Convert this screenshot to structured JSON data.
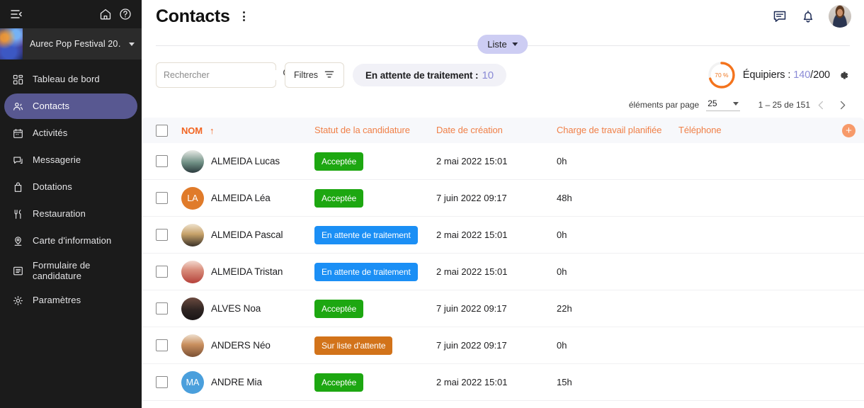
{
  "sidebar": {
    "collapse_icon": "collapse-sidebar-icon",
    "home_icon": "home-icon",
    "help_icon": "help-circle-icon",
    "workspace": {
      "name": "Aurec Pop Festival 20…"
    },
    "items": [
      {
        "label": "Tableau de bord",
        "icon": "dashboard-icon",
        "active": false
      },
      {
        "label": "Contacts",
        "icon": "contacts-icon",
        "active": true
      },
      {
        "label": "Activités",
        "icon": "calendar-icon",
        "active": false
      },
      {
        "label": "Messagerie",
        "icon": "message-icon",
        "active": false
      },
      {
        "label": "Dotations",
        "icon": "bag-icon",
        "active": false
      },
      {
        "label": "Restauration",
        "icon": "cutlery-icon",
        "active": false
      },
      {
        "label": "Carte d'information",
        "icon": "map-pin-icon",
        "active": false
      },
      {
        "label": "Formulaire de candidature",
        "icon": "form-list-icon",
        "active": false
      },
      {
        "label": "Paramètres",
        "icon": "gear-icon",
        "active": false
      }
    ]
  },
  "header": {
    "title": "Contacts",
    "kebab_icon": "more-vertical-icon",
    "chat_icon": "chat-icon",
    "bell_icon": "bell-icon",
    "avatar": "user-avatar"
  },
  "view_switch": {
    "label": "Liste"
  },
  "toolbar": {
    "search_placeholder": "Rechercher",
    "search_value": "",
    "search_icon": "search-icon",
    "filters_label": "Filtres",
    "filters_icon": "filter-icon",
    "pending_label": "En attente de traitement :",
    "pending_count": "10",
    "equipiers_label": "Équipiers :",
    "equipiers_current": "140",
    "equipiers_total": "/200",
    "progress_percent": "70 %",
    "progress_value": 70,
    "gear_icon": "gear-icon"
  },
  "pagination": {
    "per_page_label": "éléments par page",
    "per_page_value": "25",
    "range_label": "1 – 25 de 151",
    "prev_icon": "chevron-left-icon",
    "next_icon": "chevron-right-icon"
  },
  "table": {
    "columns": [
      {
        "label": "NOM",
        "sorted": true,
        "sort_arrow": "↑"
      },
      {
        "label": "Statut de la candidature"
      },
      {
        "label": "Date de création"
      },
      {
        "label": "Charge de travail planifiée"
      },
      {
        "label": "Téléphone"
      }
    ],
    "add_column_label": "+",
    "rows": [
      {
        "name": "ALMEIDA Lucas",
        "avatar_type": "photo",
        "avatar_style": "photo-a",
        "initials": "",
        "status": "Acceptée",
        "status_color": "#1da711",
        "date": "2 mai 2022 15:01",
        "workload": "0h",
        "phone": ""
      },
      {
        "name": "ALMEIDA Léa",
        "avatar_type": "initials",
        "avatar_style": "",
        "initials": "LA",
        "avatar_color": "#e07b2a",
        "status": "Acceptée",
        "status_color": "#1da711",
        "date": "7 juin 2022 09:17",
        "workload": "48h",
        "phone": ""
      },
      {
        "name": "ALMEIDA Pascal",
        "avatar_type": "photo",
        "avatar_style": "photo-b",
        "initials": "",
        "status": "En attente de traitement",
        "status_color": "#1b8ff5",
        "date": "2 mai 2022 15:01",
        "workload": "0h",
        "phone": ""
      },
      {
        "name": "ALMEIDA Tristan",
        "avatar_type": "photo",
        "avatar_style": "photo-c",
        "initials": "",
        "status": "En attente de traitement",
        "status_color": "#1b8ff5",
        "date": "2 mai 2022 15:01",
        "workload": "0h",
        "phone": ""
      },
      {
        "name": "ALVES Noa",
        "avatar_type": "photo",
        "avatar_style": "photo-d",
        "initials": "",
        "status": "Acceptée",
        "status_color": "#1da711",
        "date": "7 juin 2022 09:17",
        "workload": "22h",
        "phone": ""
      },
      {
        "name": "ANDERS Néo",
        "avatar_type": "photo",
        "avatar_style": "photo-e",
        "initials": "",
        "status": "Sur liste d'attente",
        "status_color": "#d2731a",
        "date": "7 juin 2022 09:17",
        "workload": "0h",
        "phone": ""
      },
      {
        "name": "ANDRE Mia",
        "avatar_type": "initials",
        "avatar_style": "",
        "initials": "MA",
        "avatar_color": "#4a9fdc",
        "status": "Acceptée",
        "status_color": "#1da711",
        "date": "2 mai 2022 15:01",
        "workload": "15h",
        "phone": ""
      }
    ]
  },
  "colors": {
    "sidebar_bg": "#1b1b1b",
    "active_nav": "#585891",
    "accent_orange": "#f26522",
    "accent_purple": "#8b8bd6",
    "pill_purple": "#cdcdf3"
  }
}
